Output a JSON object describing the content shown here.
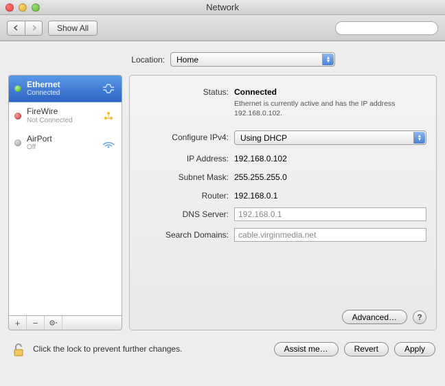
{
  "window": {
    "title": "Network"
  },
  "toolbar": {
    "show_all": "Show All"
  },
  "location": {
    "label": "Location:",
    "value": "Home"
  },
  "sidebar": {
    "items": [
      {
        "name": "Ethernet",
        "status": "Connected",
        "dot": "green",
        "icon": "ethernet"
      },
      {
        "name": "FireWire",
        "status": "Not Connected",
        "dot": "red",
        "icon": "firewire"
      },
      {
        "name": "AirPort",
        "status": "Off",
        "dot": "gray",
        "icon": "airport"
      }
    ]
  },
  "detail": {
    "status_label": "Status:",
    "status_value": "Connected",
    "status_desc": "Ethernet is currently active and has the IP address 192.168.0.102.",
    "config_label": "Configure IPv4:",
    "config_value": "Using DHCP",
    "ip_label": "IP Address:",
    "ip_value": "192.168.0.102",
    "subnet_label": "Subnet Mask:",
    "subnet_value": "255.255.255.0",
    "router_label": "Router:",
    "router_value": "192.168.0.1",
    "dns_label": "DNS Server:",
    "dns_value": "192.168.0.1",
    "search_label": "Search Domains:",
    "search_value": "cable.virginmedia.net",
    "advanced": "Advanced…"
  },
  "footer": {
    "lock_text": "Click the lock to prevent further changes.",
    "assist": "Assist me…",
    "revert": "Revert",
    "apply": "Apply"
  }
}
